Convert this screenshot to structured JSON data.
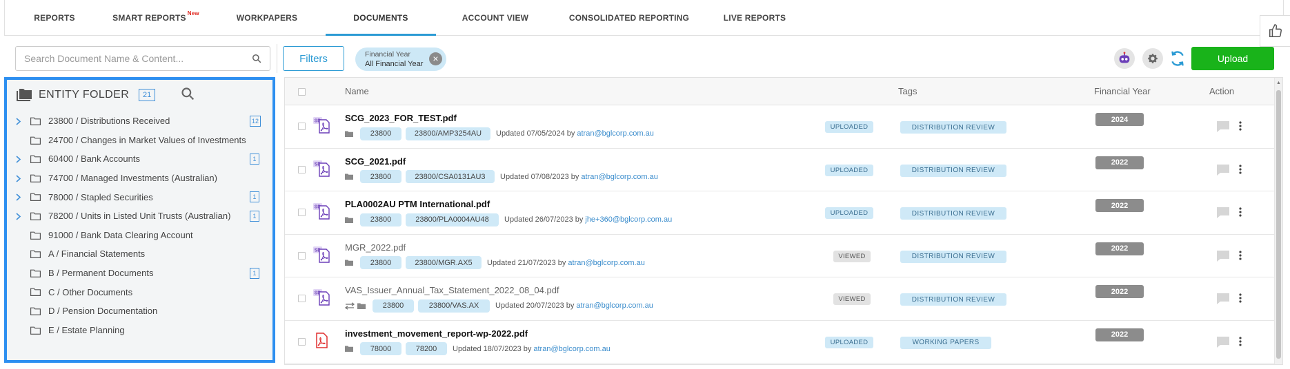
{
  "nav": {
    "tabs": [
      {
        "label": "REPORTS"
      },
      {
        "label": "SMART REPORTS",
        "badge": "New"
      },
      {
        "label": "WORKPAPERS"
      },
      {
        "label": "DOCUMENTS",
        "active": true
      },
      {
        "label": "ACCOUNT VIEW"
      },
      {
        "label": "CONSOLIDATED REPORTING"
      },
      {
        "label": "LIVE REPORTS"
      }
    ]
  },
  "toolbar": {
    "search_placeholder": "Search Document Name & Content...",
    "filters_label": "Filters",
    "fy_filter": {
      "label": "Financial Year",
      "value": "All Financial Year"
    },
    "upload_label": "Upload"
  },
  "folder_panel": {
    "title": "ENTITY FOLDER",
    "count": "21",
    "items": [
      {
        "label": "23800 / Distributions Received",
        "expandable": true,
        "count": "12"
      },
      {
        "label": "24700 / Changes in Market Values of Investments",
        "expandable": false,
        "count": ""
      },
      {
        "label": "60400 / Bank Accounts",
        "expandable": true,
        "count": "1"
      },
      {
        "label": "74700 / Managed Investments (Australian)",
        "expandable": true,
        "count": ""
      },
      {
        "label": "78000 / Stapled Securities",
        "expandable": true,
        "count": "1"
      },
      {
        "label": "78200 / Units in Listed Unit Trusts (Australian)",
        "expandable": true,
        "count": "1"
      },
      {
        "label": "91000 / Bank Data Clearing Account",
        "expandable": false,
        "count": ""
      },
      {
        "label": "A / Financial Statements",
        "expandable": false,
        "count": ""
      },
      {
        "label": "B / Permanent Documents",
        "expandable": false,
        "count": "1"
      },
      {
        "label": "C / Other Documents",
        "expandable": false,
        "count": ""
      },
      {
        "label": "D / Pension Documentation",
        "expandable": false,
        "count": ""
      },
      {
        "label": "E / Estate Planning",
        "expandable": false,
        "count": ""
      }
    ]
  },
  "table": {
    "headers": {
      "name": "Name",
      "tags": "Tags",
      "year": "Financial Year",
      "action": "Action"
    },
    "rows": [
      {
        "name": "SCG_2023_FOR_TEST.pdf",
        "bold": true,
        "sd": true,
        "chips": [
          "23800",
          "23800/AMP3254AU"
        ],
        "updated": "Updated 07/05/2024 by",
        "user": "atran@bglcorp.com.au",
        "status": "UPLOADED",
        "tag": "DISTRIBUTION REVIEW",
        "year": "2024",
        "transfer": false
      },
      {
        "name": "SCG_2021.pdf",
        "bold": true,
        "sd": true,
        "chips": [
          "23800",
          "23800/CSA0131AU3"
        ],
        "updated": "Updated 07/08/2023 by",
        "user": "atran@bglcorp.com.au",
        "status": "UPLOADED",
        "tag": "DISTRIBUTION REVIEW",
        "year": "2022",
        "transfer": false
      },
      {
        "name": "PLA0002AU PTM International.pdf",
        "bold": true,
        "sd": true,
        "chips": [
          "23800",
          "23800/PLA0004AU48"
        ],
        "updated": "Updated 26/07/2023 by",
        "user": "jhe+360@bglcorp.com.au",
        "status": "UPLOADED",
        "tag": "DISTRIBUTION REVIEW",
        "year": "2022",
        "transfer": false
      },
      {
        "name": "MGR_2022.pdf",
        "bold": false,
        "sd": true,
        "chips": [
          "23800",
          "23800/MGR.AX5"
        ],
        "updated": "Updated 21/07/2023 by",
        "user": "atran@bglcorp.com.au",
        "status": "VIEWED",
        "tag": "DISTRIBUTION REVIEW",
        "year": "2022",
        "transfer": false
      },
      {
        "name": "VAS_Issuer_Annual_Tax_Statement_2022_08_04.pdf",
        "bold": false,
        "sd": true,
        "chips": [
          "23800",
          "23800/VAS.AX"
        ],
        "updated": "Updated 20/07/2023 by",
        "user": "atran@bglcorp.com.au",
        "status": "VIEWED",
        "tag": "DISTRIBUTION REVIEW",
        "year": "2022",
        "transfer": true
      },
      {
        "name": "investment_movement_report-wp-2022.pdf",
        "bold": true,
        "sd": false,
        "chips": [
          "78000",
          "78200"
        ],
        "updated": "Updated 18/07/2023 by",
        "user": "atran@bglcorp.com.au",
        "status": "UPLOADED",
        "tag": "WORKING PAPERS",
        "year": "2022",
        "transfer": false
      }
    ]
  },
  "icons": {
    "search": "search-icon",
    "folder": "folder-icon",
    "pdf": "pdf-file-icon",
    "comment": "comment-icon",
    "kebab": "more-vertical-icon",
    "settings": "gear-icon",
    "refresh": "refresh-icon",
    "robot": "ai-assistant-icon",
    "thumb": "thumbs-up-icon"
  },
  "colors": {
    "accent": "#2c9bd4",
    "upload": "#19b31a",
    "panel_border": "#2d8ff0",
    "pdf_sd": "#6b3fb8",
    "pdf_plain": "#e03131"
  }
}
